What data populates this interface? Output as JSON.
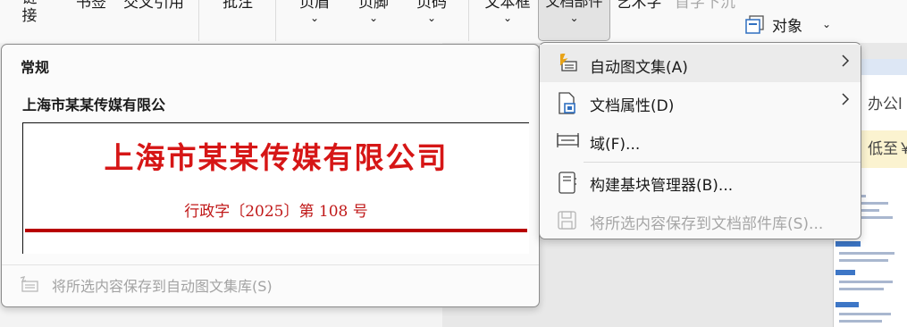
{
  "ribbon": {
    "items": [
      {
        "label": "链\n接"
      },
      {
        "label": "书签"
      },
      {
        "label": "交叉引用"
      },
      {
        "label": "批注"
      },
      {
        "label": "页眉"
      },
      {
        "label": "页脚"
      },
      {
        "label": "页码"
      },
      {
        "label": "文本框"
      },
      {
        "label": "文档部件"
      },
      {
        "label": "艺术字"
      },
      {
        "label": "首字下沉"
      }
    ],
    "object_label": "对象",
    "chevron": "⌄"
  },
  "gallery": {
    "heading": "常规",
    "entry_name": "上海市某某传媒有限公",
    "preview_title": "上海市某某传媒有限公司",
    "preview_docno": "行政字〔2025〕第 108 号",
    "save_label": "将所选内容保存到自动图文集库(S)"
  },
  "menu": {
    "items": [
      {
        "label": "自动图文集(A)",
        "icon": "autotext-icon",
        "submenu": true
      },
      {
        "label": "文档属性(D)",
        "icon": "document-property-icon",
        "submenu": true
      },
      {
        "label": "域(F)...",
        "icon": "field-icon",
        "submenu": false
      },
      {
        "label": "构建基块管理器(B)...",
        "icon": "building-blocks-icon",
        "submenu": false
      },
      {
        "label": "将所选内容保存到文档部件库(S)...",
        "icon": "save-to-gallery-icon",
        "submenu": false,
        "disabled": true
      }
    ]
  },
  "side_panel": {
    "tab_office": "办公l",
    "warn_text": "低至￥"
  },
  "colors": {
    "preview_red": "#d61616",
    "rule_red": "#b80000",
    "accent_orange": "#e8a317",
    "accent_blue": "#2f6fc0"
  }
}
